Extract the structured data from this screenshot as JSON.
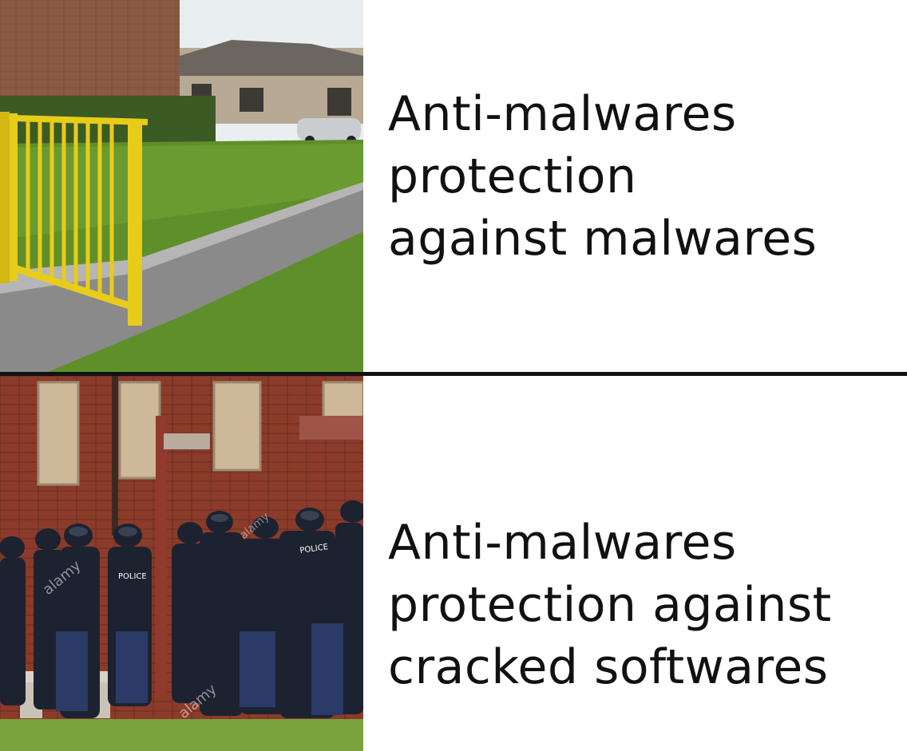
{
  "panels": [
    {
      "caption_lines": [
        "Anti-malwares",
        "protection",
        "against malwares"
      ]
    },
    {
      "caption_lines": [
        "Anti-malwares",
        "protection against",
        "cracked softwares"
      ],
      "watermark_text": "alamy",
      "vest_text": "POLICE"
    }
  ],
  "colors": {
    "gate": "#e8cc1a",
    "grass": "#5f8f2a",
    "path": "#8a8a8a",
    "brick": "#8b3b2a",
    "uniform": "#1d2230",
    "divider": "#111111",
    "text": "#111111"
  }
}
